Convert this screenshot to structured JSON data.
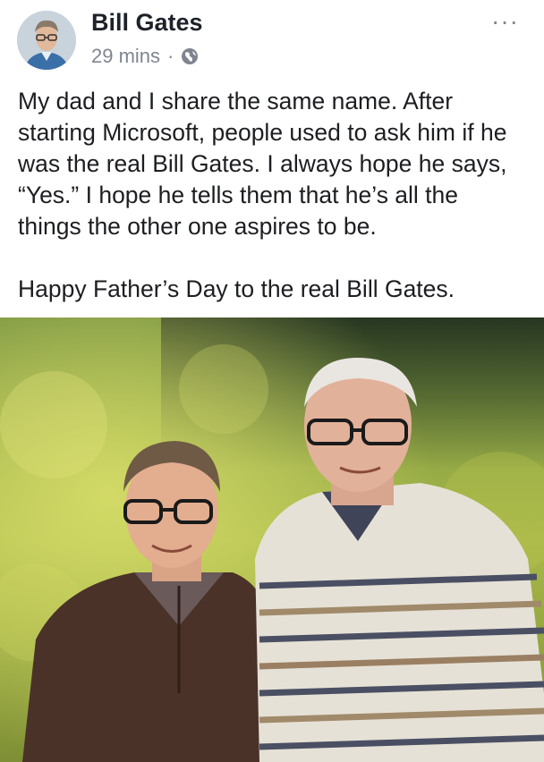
{
  "post": {
    "author": "Bill Gates",
    "time": "29 mins",
    "separator": "·",
    "privacy_icon": "globe-icon",
    "more_icon": "more-options-icon",
    "more_label": "···",
    "paragraphs": [
      "My dad and I share the same name. After starting Microsoft, people used to ask him if he was the real Bill Gates. I always hope he says, “Yes.” I hope he tells them that he’s all the things the other one aspires to be.",
      "Happy Father’s Day to the real Bill Gates."
    ]
  },
  "colors": {
    "name": "#1d2129",
    "meta": "#7f858f",
    "text": "#1c1e21"
  }
}
